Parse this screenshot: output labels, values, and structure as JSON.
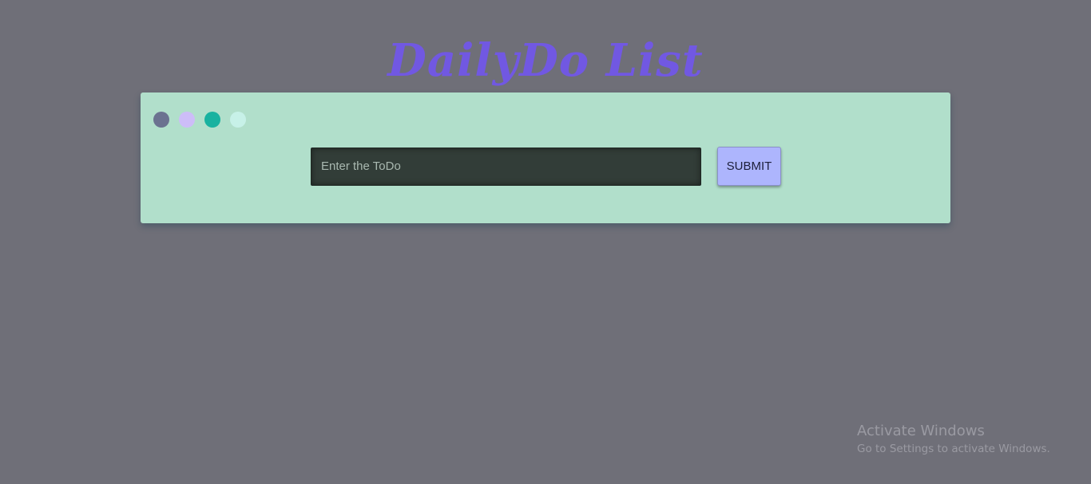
{
  "app": {
    "title": "DailyDo List"
  },
  "themes": [
    {
      "name": "slate",
      "color": "#6b7290"
    },
    {
      "name": "lavender",
      "color": "#cdbdf8"
    },
    {
      "name": "teal",
      "color": "#19b2a0"
    },
    {
      "name": "mint",
      "color": "#c7f1e8"
    }
  ],
  "todo_form": {
    "input_placeholder": "Enter the ToDo",
    "input_value": "",
    "submit_label": "SUBMIT"
  },
  "watermark": {
    "title": "Activate Windows",
    "subtitle": "Go to Settings to activate Windows."
  },
  "colors": {
    "background": "#6f6f78",
    "title": "#7158e2",
    "card": "#b1dfcb",
    "input_bg": "#323d38",
    "submit_bg": "#adb5fd"
  }
}
